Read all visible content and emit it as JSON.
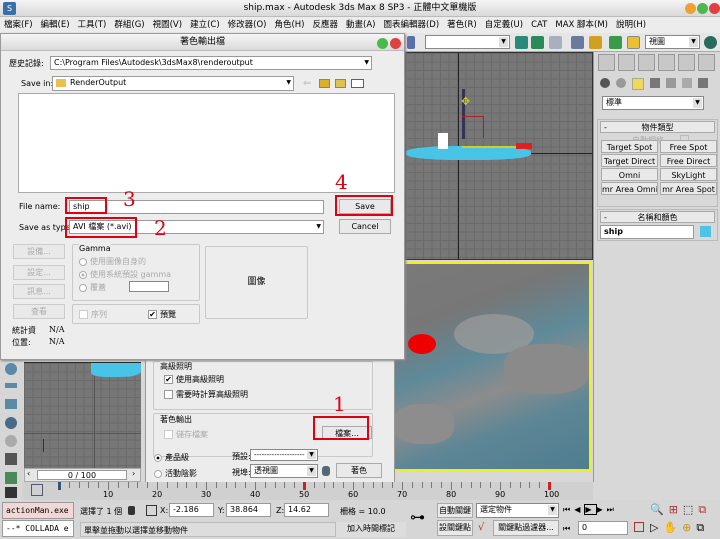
{
  "app": {
    "title": "ship.max - Autodesk 3ds Max 8 SP3 - 正體中文單機版"
  },
  "menu": [
    "檔案(F)",
    "編輯(E)",
    "工具(T)",
    "群組(G)",
    "視圖(V)",
    "建立(C)",
    "修改器(O)",
    "角色(H)",
    "反應器",
    "動畫(A)",
    "圖表編輯器(D)",
    "著色(R)",
    "自定義(U)",
    "CAT",
    "MAX 腳本(M)",
    "說明(H)"
  ],
  "toolbar": {
    "view_combo": "視圖"
  },
  "save_dialog": {
    "title": "著色輸出檔",
    "history_label": "歷史記錄:",
    "history_value": "C:\\Program Files\\Autodesk\\3dsMax8\\renderoutput",
    "save_in_label": "Save in:",
    "save_in_value": "RenderOutput",
    "file_name_label": "File name:",
    "file_name_value": "ship",
    "save_type_label": "Save as type:",
    "save_type_value": "AVI 檔案 (*.avi)",
    "save_button": "Save",
    "cancel_button": "Cancel",
    "setup_button": "設備...",
    "settings_button": "設定...",
    "info_button": "訊息...",
    "view_button": "查看",
    "gamma_label": "Gamma",
    "gamma_opt1": "使用圖像自身的",
    "gamma_opt2": "使用系統預設 gamma",
    "gamma_opt3": "覆蓋",
    "sequence_label": "序列",
    "preview_label": "預覽",
    "image_label": "圖像",
    "stats_label": "統計資",
    "stats_value": "N/A",
    "location_label": "位置:",
    "location_value": "N/A"
  },
  "annotations": [
    "1",
    "2",
    "3",
    "4"
  ],
  "render_dialog": {
    "adv_lighting_label": "高級照明",
    "use_adv_lighting": "使用高級照明",
    "compute_adv_lighting": "需要時計算高級照明",
    "render_output_label": "著色輸出",
    "save_file_label": "儲存檔案",
    "files_button": "檔案...",
    "production_label": "產品級",
    "activeshade_label": "活動陰影",
    "preset_label": "預設:",
    "preset_value": "--------------------",
    "viewport_label": "視埠:",
    "viewport_value": "透視圖",
    "render_button": "著色"
  },
  "command_panel": {
    "category_combo": "標準",
    "object_type_header": "物件類型",
    "autogrid_label": "自動網格",
    "buttons": [
      "Target Spot",
      "Free Spot",
      "Target Direct",
      "Free Direct",
      "Omni",
      "SkyLight",
      "mr Area Omni",
      "mr Area Spot"
    ],
    "name_color_header": "名稱和顏色",
    "name_value": "ship",
    "object_color": "#4fc3e6"
  },
  "viewport_left": {
    "frame_counter": "0 / 100"
  },
  "timeline": {
    "labels": [
      "10",
      "20",
      "30",
      "40",
      "50",
      "60",
      "70",
      "80",
      "90",
      "100"
    ]
  },
  "status": {
    "script_listener1": "actionMan.exe",
    "script_listener2": "--* COLLADA e",
    "selection": "選擇了 1 個",
    "x_label": "X:",
    "x_value": "-2.186",
    "y_label": "Y:",
    "y_value": "38.864",
    "z_label": "Z:",
    "z_value": "14.62",
    "grid": "柵格 = 10.0",
    "prompt": "單擊並拖動以選擇並移動物件",
    "add_time_tag": "加入時間標記",
    "auto_key": "自動關鍵",
    "set_key": "設關鍵點",
    "key_mode_combo": "選定物件",
    "key_filters": "關鍵點過濾器...",
    "frame_value": "0"
  }
}
